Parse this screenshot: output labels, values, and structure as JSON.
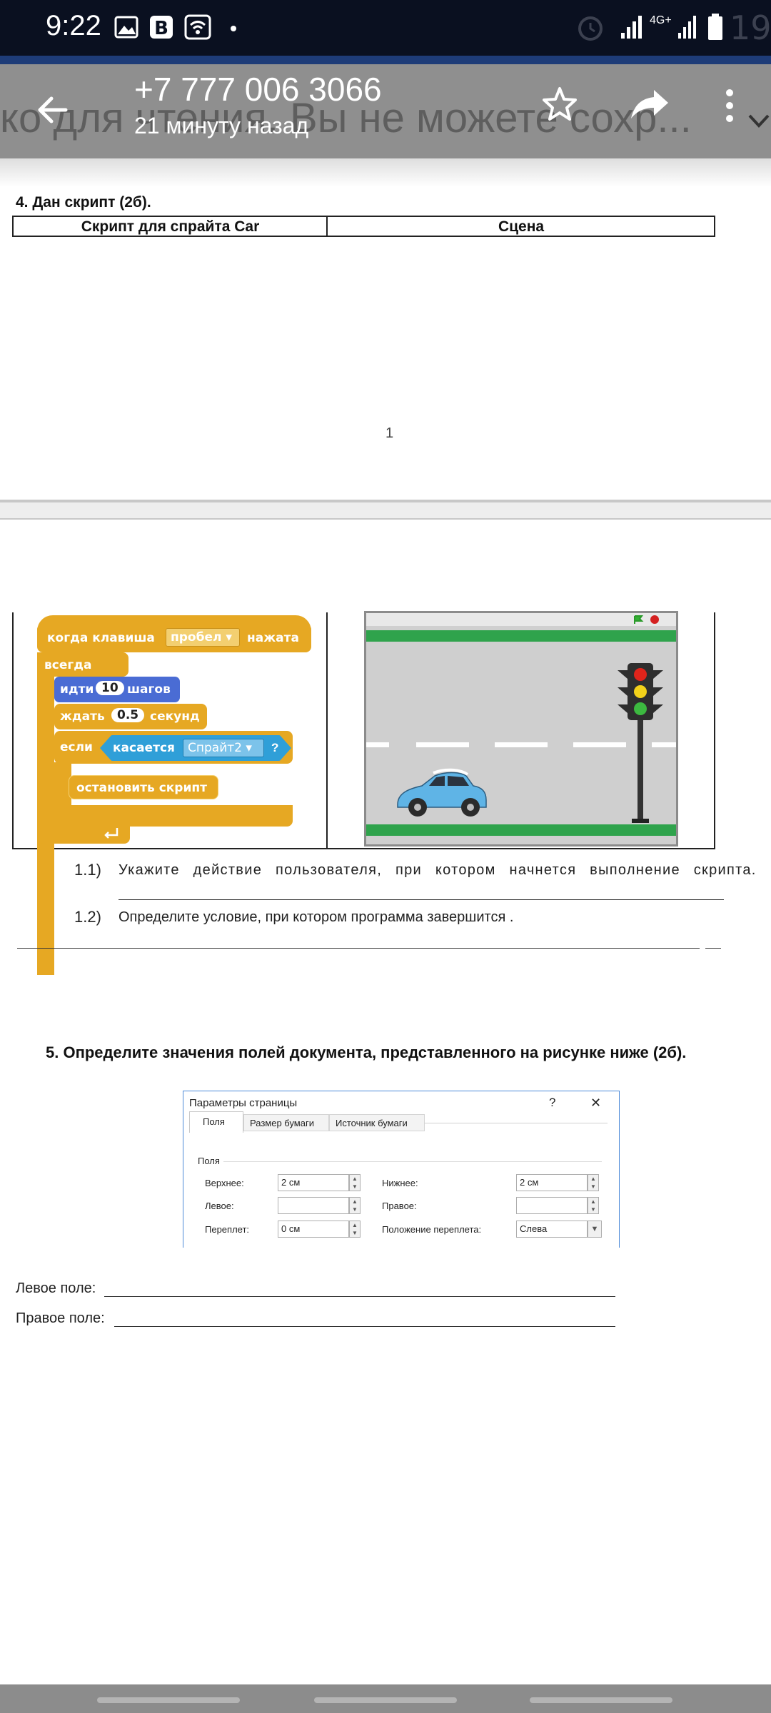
{
  "status_bar": {
    "time": "9:22",
    "network_label": "4G+",
    "ghost_battery": "19"
  },
  "app_bar": {
    "background_text": "ко для чтения. Вы не можете сохр...",
    "title": "+7 777 006 3066",
    "subtitle": "21 минуту назад"
  },
  "document": {
    "task4_title": "4. Дан скрипт (2б).",
    "col_script": "Скрипт для спрайта Car",
    "col_scene": "Сцена",
    "page_number": "1",
    "scratch": {
      "when_key": "когда клавиша",
      "key_value": "пробел",
      "pressed": "нажата",
      "forever": "всегда",
      "move": "идти",
      "steps_value": "10",
      "steps": "шагов",
      "wait": "ждать",
      "seconds_value": "0.5",
      "seconds": "секунд",
      "if": "если",
      "touching": "касается",
      "sprite": "Спрайт2",
      "question": "?",
      "stop": "остановить скрипт"
    },
    "q1_1_num": "1.1)",
    "q1_1": "Укажите действие пользователя, при котором начнется выполнение скрипта.",
    "q1_2_num": "1.2)",
    "q1_2": "Определите условие, при котором программа завершится .",
    "task5": "5. Определите значения полей документа, представленного на рисунке ниже (2б).",
    "left_field_label": "Левое поле:",
    "right_field_label": "Правое поле:"
  },
  "dialog": {
    "title": "Параметры страницы",
    "help": "?",
    "close": "✕",
    "tabs": [
      "Поля",
      "Размер бумаги",
      "Источник бумаги"
    ],
    "section": "Поля",
    "top_label": "Верхнее:",
    "top_value": "2 см",
    "bottom_label": "Нижнее:",
    "bottom_value": "2 см",
    "left_label": "Левое:",
    "left_value": "",
    "right_label": "Правое:",
    "right_value": "",
    "gutter_label": "Переплет:",
    "gutter_value": "0 см",
    "gutter_pos_label": "Положение переплета:",
    "gutter_pos_value": "Слева"
  },
  "colors": {
    "status_bg": "#0a1020",
    "app_bar_bg": "#8f8f8f",
    "scratch_orange": "#e6a823",
    "scratch_blue": "#4a6cd4",
    "scratch_cyan": "#2f9fd8"
  }
}
